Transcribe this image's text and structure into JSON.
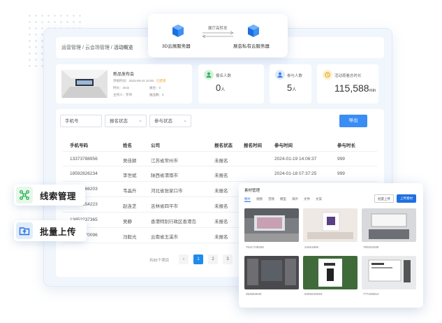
{
  "servers": {
    "left_label": "3D云展服务器",
    "right_label": "展会私有云服务器",
    "link_label": "展厅高转发"
  },
  "breadcrumb": {
    "items": [
      "运营管理",
      "云会场管理",
      "活动概览"
    ],
    "separator": " / "
  },
  "event": {
    "title": "新品发布会",
    "time": "开始时间：2023-09-24 10:00",
    "status": "已结束",
    "duration": "时长：3min",
    "booths": "展台：0",
    "host": "主持人：罗玮",
    "exhibits": "展品数：0"
  },
  "stats": [
    {
      "label": "报名人数",
      "value": "0",
      "unit": "人"
    },
    {
      "label": "参与人数",
      "value": "5",
      "unit": "人"
    },
    {
      "label": "活动观看总时长",
      "value": "115,588",
      "unit": "min"
    }
  ],
  "filters": {
    "phone_placeholder": "手机号",
    "signup_status": "报名状态",
    "join_status": "参与状态",
    "export": "导出"
  },
  "table": {
    "headers": [
      "手机号码",
      "姓名",
      "公司",
      "报名状态",
      "报名时间",
      "参与时间",
      "参与时长"
    ],
    "rows": [
      [
        "13373788956",
        "吴佳颖",
        "江苏省常州市",
        "未报名",
        "",
        "2024-01-19 14:06:37",
        "999"
      ],
      [
        "18592826234",
        "李世斌",
        "陕西省渭南市",
        "未报名",
        "",
        "2024-01-18 07:37:25",
        "999"
      ],
      [
        "15836266203",
        "韦晶升",
        "河北省张家口市",
        "未报名",
        "",
        "",
        ""
      ],
      [
        "13862854223",
        "赵连芝",
        "吉林省四平市",
        "未报名",
        "",
        "",
        ""
      ],
      [
        "13852237365",
        "吴静",
        "香港特别行政区香港岛",
        "未报名",
        "",
        "",
        ""
      ],
      [
        "13938970096",
        "冯毅光",
        "云南省玉溪市",
        "未报名",
        "",
        "",
        ""
      ]
    ]
  },
  "pagination": {
    "total": "共85个项目",
    "prev": "‹",
    "pages": [
      "1",
      "2",
      "3"
    ]
  },
  "badges": {
    "leads": "线索管理",
    "bulk_upload": "批量上传"
  },
  "materials": {
    "title": "素材管理",
    "tabs": [
      "图片",
      "视频",
      "音频",
      "模型",
      "海外",
      "文件",
      "文案"
    ],
    "batch_upload": "批量上传",
    "upload": "上传素材",
    "items": [
      {
        "id": "761C748328"
      },
      {
        "id": "34451806"
      },
      {
        "id": "750222205"
      },
      {
        "id": "362663940"
      },
      {
        "id": "529324263S"
      },
      {
        "id": "777445614"
      }
    ]
  },
  "colors": {
    "accent": "#1f8ceb",
    "leads_icon_bg": "#e7f7ea",
    "upload_icon_bg": "#e2edfb"
  }
}
